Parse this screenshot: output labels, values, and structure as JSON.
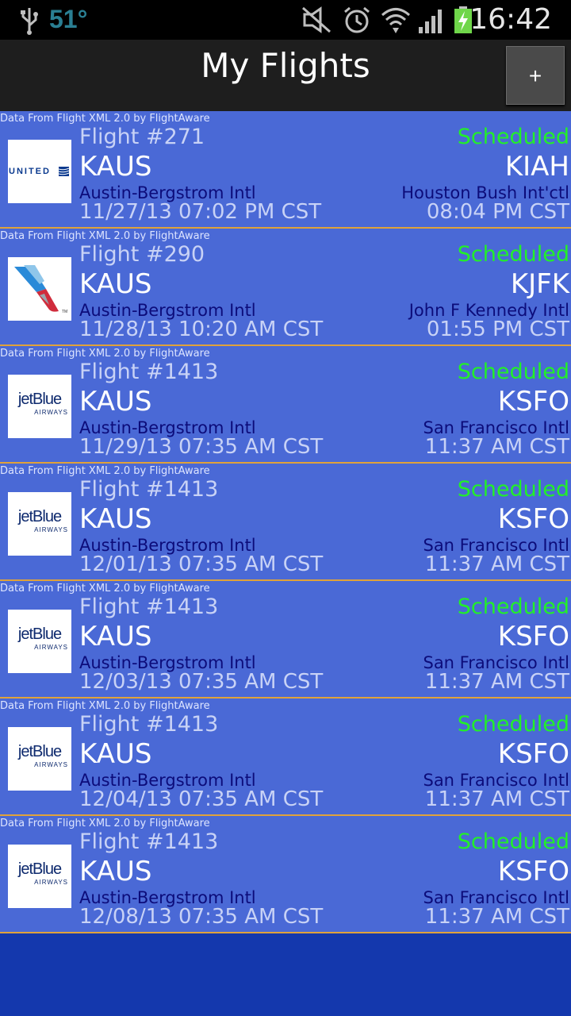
{
  "status_bar": {
    "temperature": "51°",
    "time": "16:42",
    "icons": [
      "usb-icon",
      "mute-icon",
      "alarm-icon",
      "wifi-icon",
      "signal-icon",
      "battery-charging-icon"
    ]
  },
  "action_bar": {
    "title": "My Flights",
    "add_label": "+"
  },
  "flights": [
    {
      "credit": "Data From Flight XML 2.0 by FlightAware",
      "airline_logo": "united-logo",
      "flight": "Flight #271",
      "status": "Scheduled",
      "origin_code": "KAUS",
      "dest_code": "KIAH",
      "origin_name": "Austin-Bergstrom Intl",
      "dest_name": "Houston Bush Int'ctl",
      "depart": "11/27/13 07:02 PM CST",
      "arrive": "08:04 PM CST"
    },
    {
      "credit": "Data From Flight XML 2.0 by FlightAware",
      "airline_logo": "american-logo",
      "flight": "Flight #290",
      "status": "Scheduled",
      "origin_code": "KAUS",
      "dest_code": "KJFK",
      "origin_name": "Austin-Bergstrom Intl",
      "dest_name": "John F Kennedy Intl",
      "depart": "11/28/13 10:20 AM CST",
      "arrive": "01:55 PM CST"
    },
    {
      "credit": "Data From Flight XML 2.0 by FlightAware",
      "airline_logo": "jetblue-logo",
      "flight": "Flight #1413",
      "status": "Scheduled",
      "origin_code": "KAUS",
      "dest_code": "KSFO",
      "origin_name": "Austin-Bergstrom Intl",
      "dest_name": "San Francisco Intl",
      "depart": "11/29/13 07:35 AM CST",
      "arrive": "11:37 AM CST"
    },
    {
      "credit": "Data From Flight XML 2.0 by FlightAware",
      "airline_logo": "jetblue-logo",
      "flight": "Flight #1413",
      "status": "Scheduled",
      "origin_code": "KAUS",
      "dest_code": "KSFO",
      "origin_name": "Austin-Bergstrom Intl",
      "dest_name": "San Francisco Intl",
      "depart": "12/01/13 07:35 AM CST",
      "arrive": "11:37 AM CST"
    },
    {
      "credit": "Data From Flight XML 2.0 by FlightAware",
      "airline_logo": "jetblue-logo",
      "flight": "Flight #1413",
      "status": "Scheduled",
      "origin_code": "KAUS",
      "dest_code": "KSFO",
      "origin_name": "Austin-Bergstrom Intl",
      "dest_name": "San Francisco Intl",
      "depart": "12/03/13 07:35 AM CST",
      "arrive": "11:37 AM CST"
    },
    {
      "credit": "Data From Flight XML 2.0 by FlightAware",
      "airline_logo": "jetblue-logo",
      "flight": "Flight #1413",
      "status": "Scheduled",
      "origin_code": "KAUS",
      "dest_code": "KSFO",
      "origin_name": "Austin-Bergstrom Intl",
      "dest_name": "San Francisco Intl",
      "depart": "12/04/13 07:35 AM CST",
      "arrive": "11:37 AM CST"
    },
    {
      "credit": "Data From Flight XML 2.0 by FlightAware",
      "airline_logo": "jetblue-logo",
      "flight": "Flight #1413",
      "status": "Scheduled",
      "origin_code": "KAUS",
      "dest_code": "KSFO",
      "origin_name": "Austin-Bergstrom Intl",
      "dest_name": "San Francisco Intl",
      "depart": "12/08/13 07:35 AM CST",
      "arrive": "11:37 AM CST"
    }
  ],
  "logos": {
    "united_text": "UNITED",
    "jetblue_text": "jetBlue",
    "jetblue_sub": "AIRWAYS",
    "american_tm": "TM"
  },
  "colors": {
    "card_bg": "#4a69d6",
    "separator": "#e0a23a",
    "status_green": "#22f028",
    "screen_bg": "#1438ad"
  }
}
